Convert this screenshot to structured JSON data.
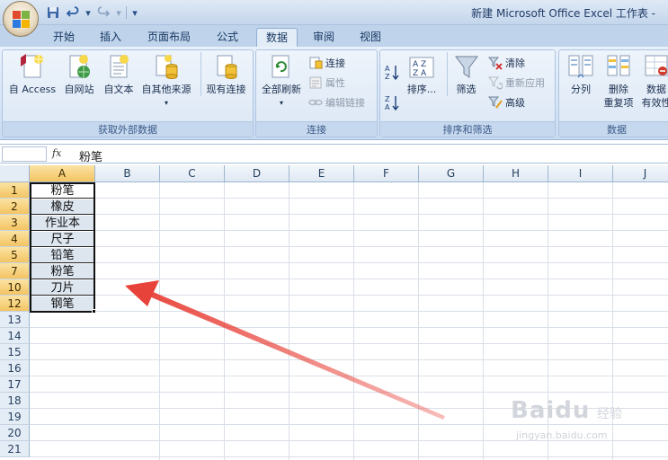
{
  "window": {
    "title": "新建 Microsoft Office Excel 工作表 -"
  },
  "quick_access": {
    "icons": [
      "save-icon",
      "undo-icon",
      "redo-icon",
      "customize-icon"
    ]
  },
  "tabs": [
    {
      "label": "开始"
    },
    {
      "label": "插入"
    },
    {
      "label": "页面布局"
    },
    {
      "label": "公式"
    },
    {
      "label": "数据",
      "active": true
    },
    {
      "label": "审阅"
    },
    {
      "label": "视图"
    }
  ],
  "ribbon": {
    "external": {
      "label": "获取外部数据",
      "access": "自 Access",
      "web": "自网站",
      "text": "自文本",
      "other": "自其他来源",
      "existing": "现有连接"
    },
    "connections": {
      "label": "连接",
      "refresh_all": "全部刷新",
      "connect": "连接",
      "properties": "属性",
      "edit_links": "编辑链接"
    },
    "sort_filter": {
      "label": "排序和筛选",
      "sort": "排序...",
      "filter": "筛选",
      "clear": "清除",
      "reapply": "重新应用",
      "advanced": "高级"
    },
    "data_tools": {
      "label": "数据",
      "split": "分列",
      "remove_dup_line1": "删除",
      "remove_dup_line2": "重复项",
      "validation_line1": "数据",
      "validation_line2": "有效性"
    }
  },
  "formula_bar": {
    "fx_label": "fx",
    "content": "粉笔"
  },
  "sheet": {
    "columns": [
      "A",
      "B",
      "C",
      "D",
      "E",
      "F",
      "G",
      "H",
      "I",
      "J"
    ],
    "rows": [
      {
        "num": "1",
        "value": "粉笔"
      },
      {
        "num": "2",
        "value": "橡皮"
      },
      {
        "num": "3",
        "value": "作业本"
      },
      {
        "num": "4",
        "value": "尺子"
      },
      {
        "num": "5",
        "value": "铅笔"
      },
      {
        "num": "7",
        "value": "粉笔"
      },
      {
        "num": "10",
        "value": "刀片"
      },
      {
        "num": "12",
        "value": "钢笔"
      },
      {
        "num": "13",
        "value": ""
      },
      {
        "num": "14",
        "value": ""
      },
      {
        "num": "15",
        "value": ""
      },
      {
        "num": "16",
        "value": ""
      },
      {
        "num": "17",
        "value": ""
      },
      {
        "num": "18",
        "value": ""
      },
      {
        "num": "19",
        "value": ""
      },
      {
        "num": "20",
        "value": ""
      },
      {
        "num": "21",
        "value": ""
      }
    ]
  },
  "watermark": {
    "brand": "Baidu",
    "suffix": "经验",
    "url": "jingyan.baidu.com"
  },
  "colors": {
    "arrow": "#e8433a",
    "selection_header": "#f3c463",
    "ribbon": "#dbe7f5"
  }
}
